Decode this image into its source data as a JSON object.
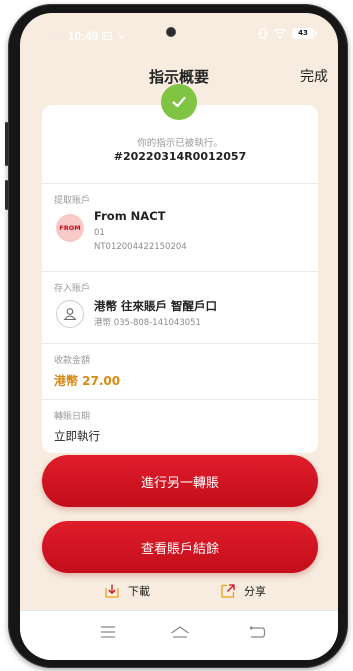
{
  "status_bar": {
    "signal_dots": ".....",
    "time": "10:49",
    "arrow": "↘",
    "battery": "43"
  },
  "header": {
    "title": "指示概要",
    "done_label": "完成"
  },
  "summary": {
    "status_text": "你的指示已被執行。",
    "reference": "#20220314R0012057"
  },
  "from_account": {
    "label": "提取賬戶",
    "badge": "FROM",
    "name": "From NACT",
    "line1": "01",
    "line2": "NT012004422150204"
  },
  "to_account": {
    "label": "存入賬戶",
    "name": "港幣 往來賬戶 智醒戶口",
    "number": "港幣 035-808-141043051"
  },
  "amount": {
    "label": "收款金額",
    "value": "港幣 27.00"
  },
  "transfer_date": {
    "label": "轉賬日期",
    "value": "立即執行"
  },
  "buttons": {
    "another_transfer": "進行另一轉賬",
    "view_balance": "查看賬戶結餘"
  },
  "actions": {
    "download": "下載",
    "share": "分享"
  },
  "colors": {
    "primary_red": "#d2121f",
    "success_green": "#7fc442",
    "amount_orange": "#d88a10",
    "background": "#f7ecdf"
  },
  "icons": {
    "check": "check-icon",
    "person": "person-icon",
    "download": "download-icon",
    "share": "share-icon",
    "menu": "menu-icon",
    "home": "home-icon",
    "back": "back-icon"
  }
}
